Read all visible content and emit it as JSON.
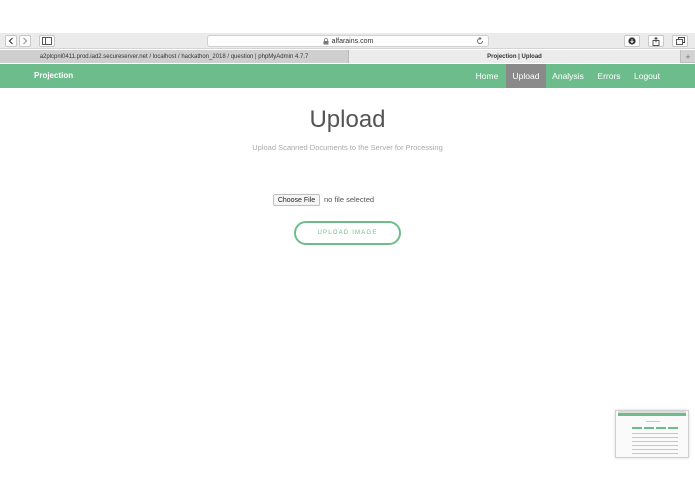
{
  "browser": {
    "url": "alfarains.com",
    "tabs": [
      {
        "label": "a2plcpnl0411.prod.iad2.secureserver.net / localhost / hackathon_2018 / question | phpMyAdmin 4.7.7"
      },
      {
        "label": "Projection | Upload"
      }
    ],
    "new_tab_label": "+"
  },
  "navbar": {
    "brand": "Projection",
    "items": [
      {
        "label": "Home"
      },
      {
        "label": "Upload"
      },
      {
        "label": "Analysis"
      },
      {
        "label": "Errors"
      },
      {
        "label": "Logout"
      }
    ],
    "active": "Upload"
  },
  "main": {
    "title": "Upload",
    "subtitle": "Upload Scanned Documents to the Server for Processing",
    "file_button": "Choose File",
    "file_status": "no file selected",
    "upload_button": "UPLOAD IMAGE"
  },
  "icons": {
    "back": "chevron-left-icon",
    "forward": "chevron-right-icon",
    "sidebar": "sidebar-icon",
    "lock": "lock-icon",
    "reload": "reload-icon",
    "download": "download-icon",
    "share": "share-icon",
    "tabs": "tabs-icon"
  },
  "colors": {
    "accent": "#6dbd8c",
    "active_nav": "#8a8a8a"
  }
}
